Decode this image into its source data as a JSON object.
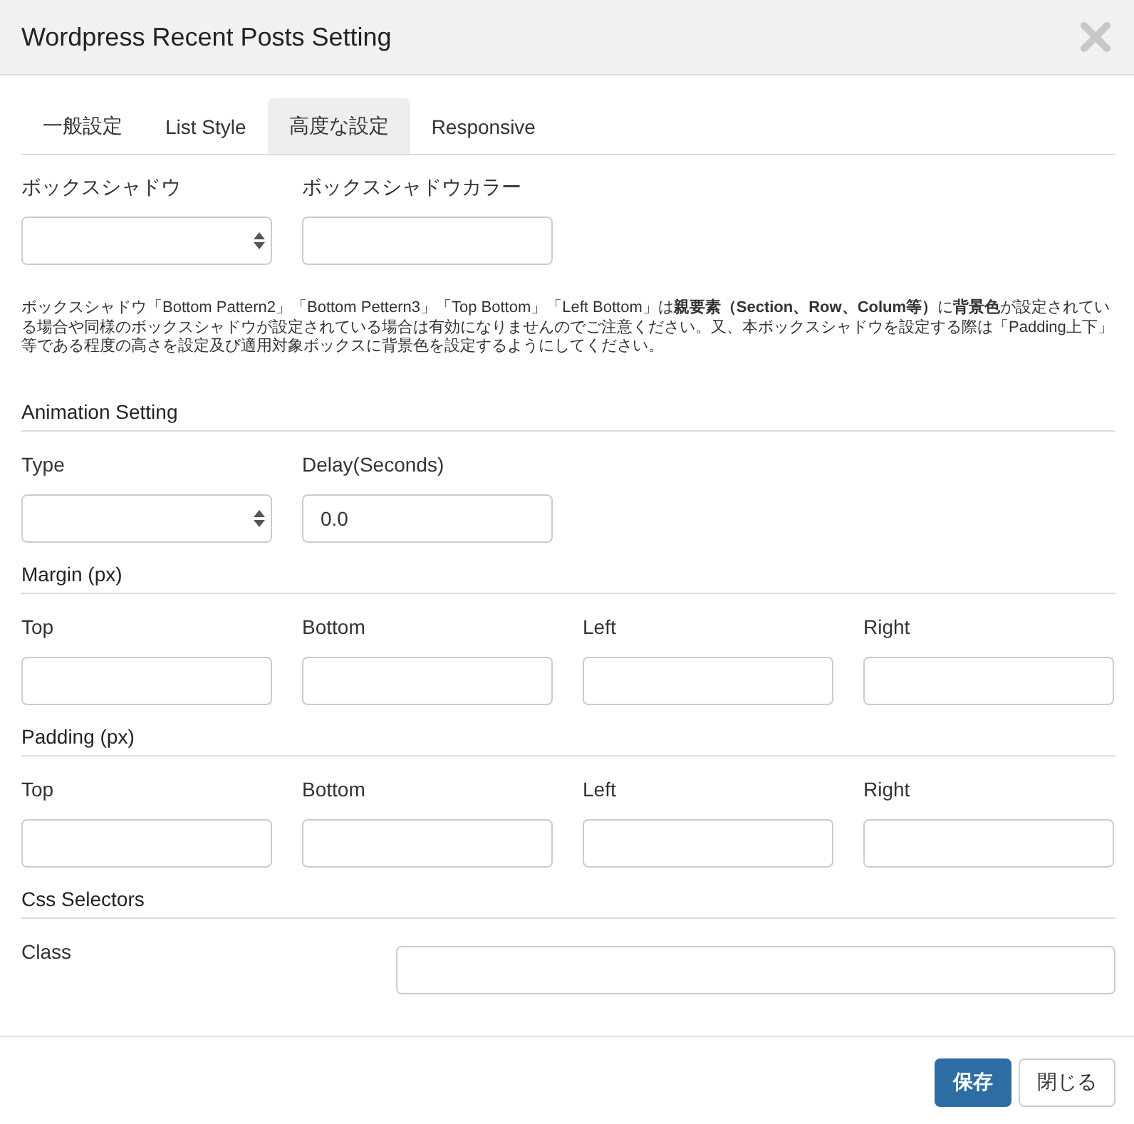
{
  "window": {
    "title": "Wordpress Recent Posts Setting"
  },
  "tabs": [
    {
      "label": "一般設定",
      "selected": false
    },
    {
      "label": "List Style",
      "selected": false
    },
    {
      "label": "高度な設定",
      "selected": true
    },
    {
      "label": "Responsive",
      "selected": false
    }
  ],
  "box_shadow": {
    "fields": [
      {
        "label": "ボックスシャドウ",
        "kind": "select"
      },
      {
        "label": "ボックスシャドウカラー",
        "kind": "text"
      }
    ],
    "note": "ボックスシャドウ「Bottom Pattern2」「Bottom Pettern3」「Top Bottom」「Left Bottom」は**親要素（Section、Row、Colum等）**に**背景色**が設定されている場合や同様のボックスシャドウが設定されている場合は有効になりませんのでご注意ください。又、本ボックスシャドウを設定する際は「Padding上下」等である程度の高さを設定及び適用対象ボックスに背景色を設定するようにしてください。"
  },
  "sections": [
    {
      "heading": "Animation Setting",
      "kind": "grid",
      "fields": [
        {
          "label": "Type",
          "kind": "select"
        },
        {
          "label": "Delay(Seconds)",
          "kind": "text",
          "value": "0.0"
        }
      ]
    },
    {
      "heading": "Margin (px)",
      "kind": "grid",
      "fields": [
        {
          "label": "Top",
          "kind": "text"
        },
        {
          "label": "Bottom",
          "kind": "text"
        },
        {
          "label": "Left",
          "kind": "text"
        },
        {
          "label": "Right",
          "kind": "text"
        }
      ]
    },
    {
      "heading": "Padding (px)",
      "kind": "grid",
      "fields": [
        {
          "label": "Top",
          "kind": "text"
        },
        {
          "label": "Bottom",
          "kind": "text"
        },
        {
          "label": "Left",
          "kind": "text"
        },
        {
          "label": "Right",
          "kind": "text"
        }
      ]
    },
    {
      "heading": "Css Selectors",
      "kind": "inline",
      "fields": [
        {
          "label": "Class",
          "kind": "text"
        }
      ]
    }
  ],
  "buttons": [
    {
      "label": "保存",
      "kind": "primary"
    },
    {
      "label": "閉じる",
      "kind": "default"
    }
  ]
}
